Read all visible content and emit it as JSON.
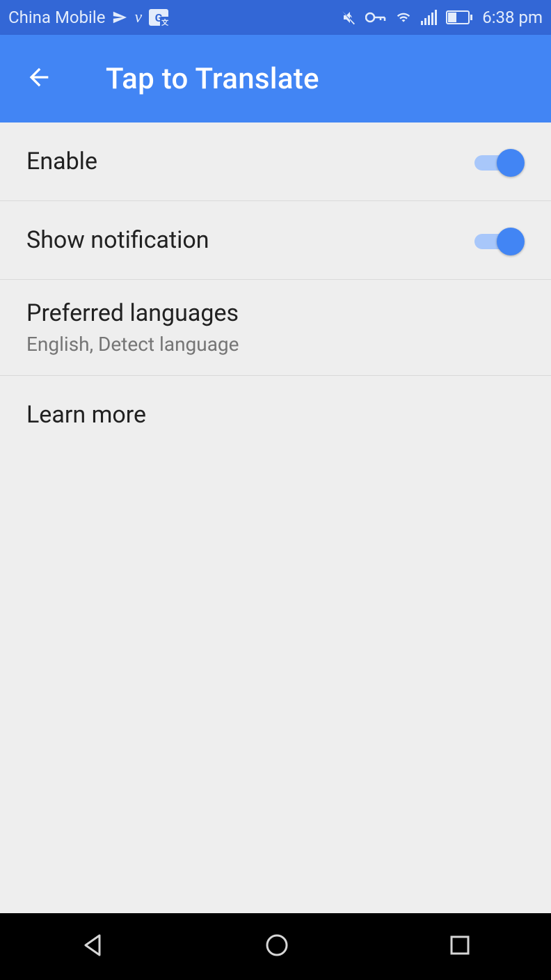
{
  "status": {
    "carrier": "China Mobile",
    "time": "6:38 pm"
  },
  "header": {
    "title": "Tap to Translate"
  },
  "settings": {
    "enable": {
      "label": "Enable",
      "on": true
    },
    "notify": {
      "label": "Show notification",
      "on": true
    },
    "languages": {
      "label": "Preferred languages",
      "subtitle": "English, Detect language"
    },
    "learn": {
      "label": "Learn more"
    }
  }
}
